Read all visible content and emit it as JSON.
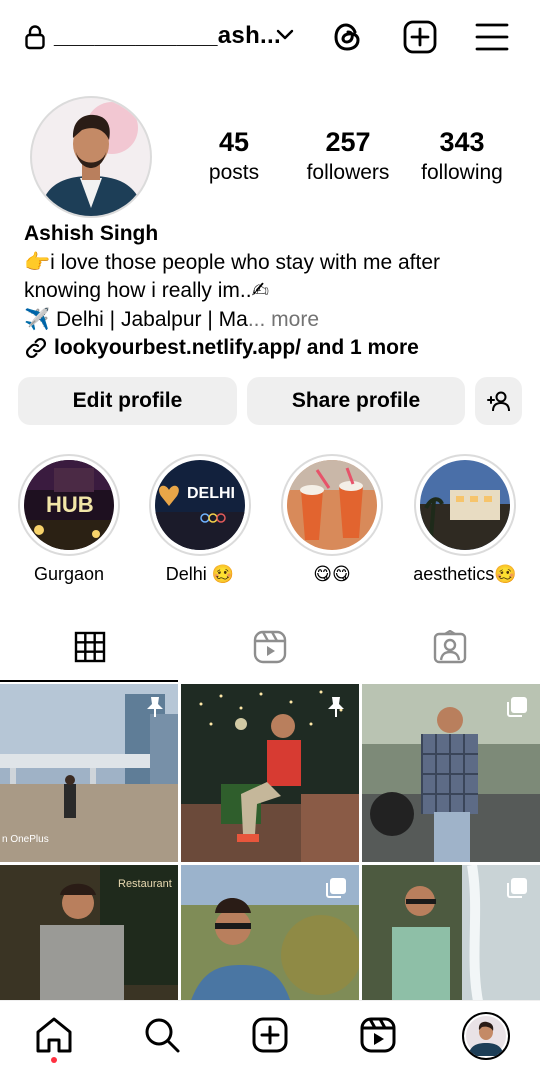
{
  "header": {
    "username": "____________ash...",
    "icons": [
      "lock-icon",
      "chevron-down-icon",
      "threads-icon",
      "add-post-icon",
      "hamburger-menu-icon"
    ]
  },
  "profile": {
    "stats": [
      {
        "value": "45",
        "label": "posts"
      },
      {
        "value": "257",
        "label": "followers"
      },
      {
        "value": "343",
        "label": "following"
      }
    ],
    "name": "Ashish Singh",
    "bio_line1": "👉i love those people who stay with me after",
    "bio_line2": "knowing how i really im..✍",
    "bio_line3": "✈️ Delhi | Jabalpur | Ma",
    "bio_ellipsis": "...",
    "bio_more": " more",
    "link_text": "lookyourbest.netlify.app/ and 1 more"
  },
  "actions": {
    "edit_label": "Edit profile",
    "share_label": "Share profile"
  },
  "highlights": [
    {
      "label": "Gurgaon"
    },
    {
      "label": "Delhi 🥴"
    },
    {
      "label": "😋😋"
    },
    {
      "label": "aesthetics🥴"
    }
  ],
  "highlight_texts": {
    "h1": "HUB",
    "h2": "DELHI"
  },
  "tabs": [
    "grid-tab",
    "reels-tab",
    "tagged-tab"
  ],
  "grid_watermark": "n OnePlus",
  "grid_sign": "Restaurant",
  "nav": [
    "home-icon",
    "search-icon",
    "create-icon",
    "reels-icon",
    "profile-avatar"
  ],
  "colors": {
    "button_bg": "#efefef",
    "more_gray": "#737373",
    "notification_dot": "#ff3040"
  }
}
